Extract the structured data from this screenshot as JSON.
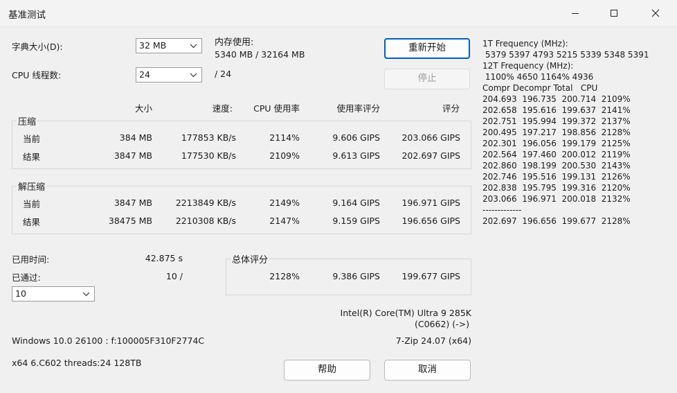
{
  "window": {
    "title": "基准测试"
  },
  "controls": {
    "dict_label": "字典大小(D):",
    "dict_value": "32 MB",
    "threads_label": "CPU 线程数:",
    "threads_value": "24",
    "threads_total": "/ 24",
    "mem_label": "内存使用:",
    "mem_value": "5340 MB / 32164 MB",
    "restart_label": "重新开始",
    "stop_label": "停止"
  },
  "table": {
    "headers": {
      "size": "大小",
      "speed": "速度:",
      "cpu": "CPU 使用率",
      "rating_cpu": "使用率评分",
      "rating": "评分"
    },
    "compress": {
      "label": "压缩",
      "rows": [
        {
          "name": "当前",
          "size": "384 MB",
          "speed": "177853 KB/s",
          "cpu": "2114%",
          "rating_cpu": "9.606 GIPS",
          "rating": "203.066 GIPS"
        },
        {
          "name": "结果",
          "size": "3847 MB",
          "speed": "177530 KB/s",
          "cpu": "2109%",
          "rating_cpu": "9.613 GIPS",
          "rating": "202.697 GIPS"
        }
      ]
    },
    "decompress": {
      "label": "解压缩",
      "rows": [
        {
          "name": "当前",
          "size": "3847 MB",
          "speed": "2213849 KB/s",
          "cpu": "2149%",
          "rating_cpu": "9.164 GIPS",
          "rating": "196.971 GIPS"
        },
        {
          "name": "结果",
          "size": "38475 MB",
          "speed": "2210308 KB/s",
          "cpu": "2147%",
          "rating_cpu": "9.159 GIPS",
          "rating": "196.656 GIPS"
        }
      ]
    }
  },
  "stats": {
    "elapsed_label": "已用时间:",
    "elapsed_value": "42.875 s",
    "passes_label": "已通过:",
    "passes_value": "10 /",
    "passes_select": "10"
  },
  "total": {
    "label": "总体评分",
    "cpu": "2128%",
    "rating_cpu": "9.386 GIPS",
    "rating": "199.677 GIPS"
  },
  "system": {
    "cpu_line1": "Intel(R) Core(TM) Ultra 9 285K",
    "cpu_line2": "(C0662) (->)",
    "os": "Windows 10.0 26100 : f:100005F310F2774C",
    "version": "7-Zip 24.07 (x64)",
    "arch": "x64 6.C602 threads:24 128TB"
  },
  "buttons": {
    "help": "帮助",
    "cancel": "取消"
  },
  "right_panel": {
    "f1_label": "1T Frequency (MHz):",
    "f1_values": " 5379 5397 4793 5215 5339 5348 5391",
    "f12_label": "12T Frequency (MHz):",
    "f12_values": " 1100% 4650 1164% 4936",
    "header": "Compr Decompr Total   CPU",
    "rows": [
      "204.693  196.735  200.714  2109%",
      "202.658  195.616  199.637  2141%",
      "202.751  195.994  199.372  2137%",
      "200.495  197.217  198.856  2128%",
      "202.301  196.056  199.179  2125%",
      "202.564  197.460  200.012  2119%",
      "202.860  198.199  200.530  2143%",
      "202.746  195.516  199.131  2126%",
      "202.838  195.795  199.316  2120%",
      "203.066  196.971  200.018  2132%"
    ],
    "separator": "-------------",
    "summary": "202.697  196.656  199.677  2128%"
  }
}
